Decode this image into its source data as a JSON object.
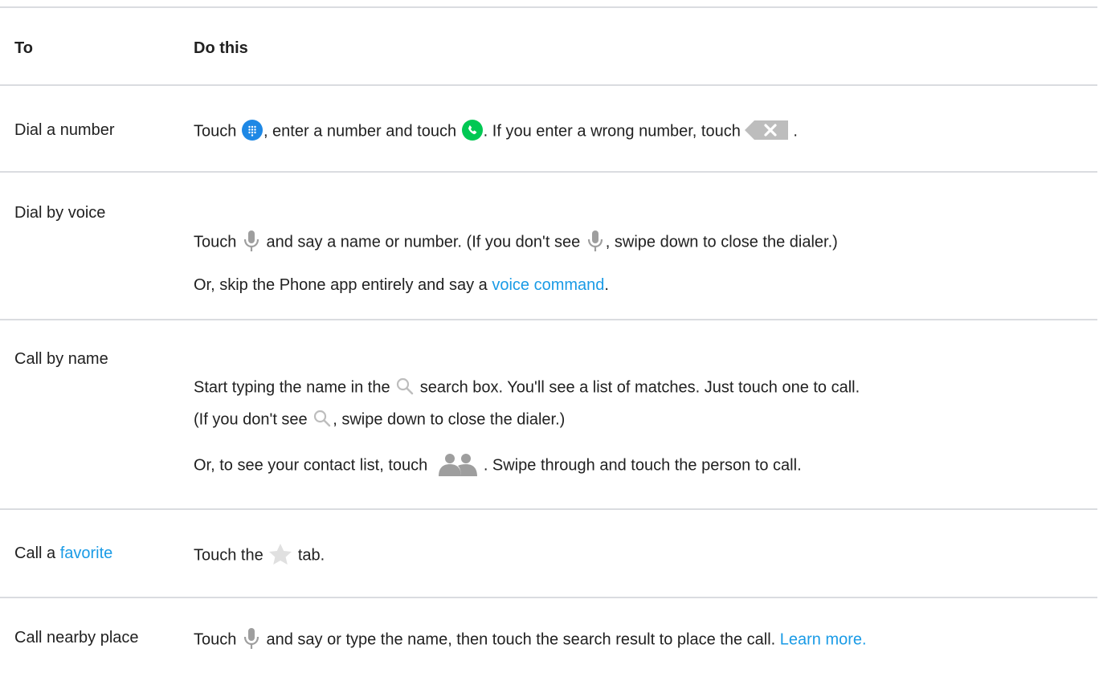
{
  "header": {
    "col1": "To",
    "col2": "Do this"
  },
  "rows": {
    "dial_number": {
      "label": "Dial a number",
      "t1": "Touch",
      "t2": ", enter a number and touch",
      "t3": ". If you enter a wrong number, touch",
      "t4": ".",
      "icons": [
        "dialpad-icon",
        "call-icon",
        "backspace-icon"
      ]
    },
    "dial_voice": {
      "label": "Dial by voice",
      "t1": "Touch",
      "t2": "and say a name or number. (If you don't see",
      "t3": ", swipe down to close the dialer.)",
      "p2_text": "Or, skip the Phone app entirely and say a",
      "p2_link": "voice command",
      "p2_end": ".",
      "icons": [
        "microphone-icon"
      ]
    },
    "call_name": {
      "label": "Call by name",
      "t1": "Start typing the name in the",
      "t2": "search box. You'll see a list of matches. Just touch one to call.",
      "t3": "(If you don't see",
      "t4": ", swipe down to close the dialer.)",
      "p2_text": "Or, to see your contact list, touch",
      "p2_end": ". Swipe through and touch the person to call.",
      "icons": [
        "search-icon",
        "contacts-icon"
      ]
    },
    "call_favorite": {
      "label_prefix": "Call a",
      "label_link": "favorite",
      "t1": "Touch the",
      "t2": "tab.",
      "icons": [
        "star-icon"
      ]
    },
    "call_place": {
      "label": "Call nearby place",
      "t1": "Touch",
      "t2": "and say or type the name, then touch the search result to place the call.",
      "link": "Learn more.",
      "icons": [
        "microphone-icon"
      ]
    }
  },
  "colors": {
    "link": "#1a9be6",
    "rule": "#dadce0",
    "text": "#212121",
    "dialpad": "#1e88e5",
    "call": "#00c853",
    "icon_gray": "#9e9e9e"
  }
}
